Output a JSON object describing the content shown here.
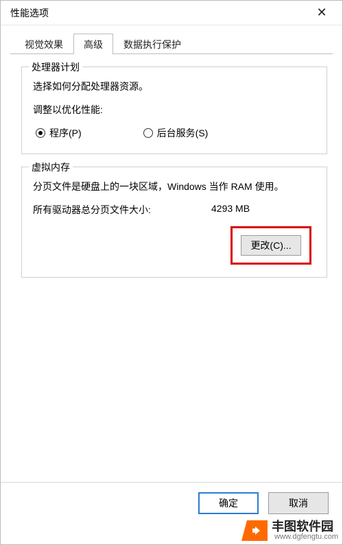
{
  "window": {
    "title": "性能选项",
    "close_glyph": "✕"
  },
  "tabs": {
    "visual": "视觉效果",
    "advanced": "高级",
    "dep": "数据执行保护"
  },
  "cpu_group": {
    "title": "处理器计划",
    "desc": "选择如何分配处理器资源。",
    "adjust_label": "调整以优化性能:",
    "programs": "程序(P)",
    "background": "后台服务(S)"
  },
  "vm_group": {
    "title": "虚拟内存",
    "desc": "分页文件是硬盘上的一块区域，Windows 当作 RAM 使用。",
    "total_label": "所有驱动器总分页文件大小:",
    "total_value": "4293 MB",
    "change": "更改(C)..."
  },
  "footer": {
    "ok": "确定",
    "cancel": "取消"
  },
  "watermark": {
    "name": "丰图软件园",
    "url": "www.dgfengtu.com"
  }
}
